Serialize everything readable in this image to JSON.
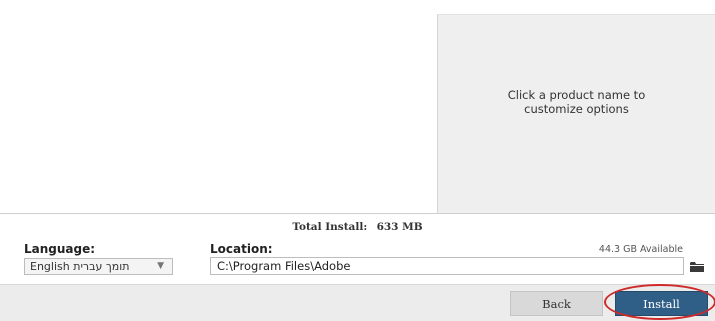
{
  "product_panel": {
    "hint": "Click a product name to customize options"
  },
  "summary": {
    "total_label": "Total Install:",
    "total_value": "633 MB",
    "available": "44.3 GB Available"
  },
  "language": {
    "label": "Language:",
    "selected": "English תומך עברית"
  },
  "location": {
    "label": "Location:",
    "value": "C:\\Program Files\\Adobe"
  },
  "footer": {
    "back_label": "Back",
    "install_label": "Install"
  },
  "colors": {
    "install_button": "#2f5e86",
    "annotation_circle": "#cf2a2a"
  },
  "icons": {
    "folder": "folder-icon",
    "dropdown": "chevron-down-icon"
  }
}
